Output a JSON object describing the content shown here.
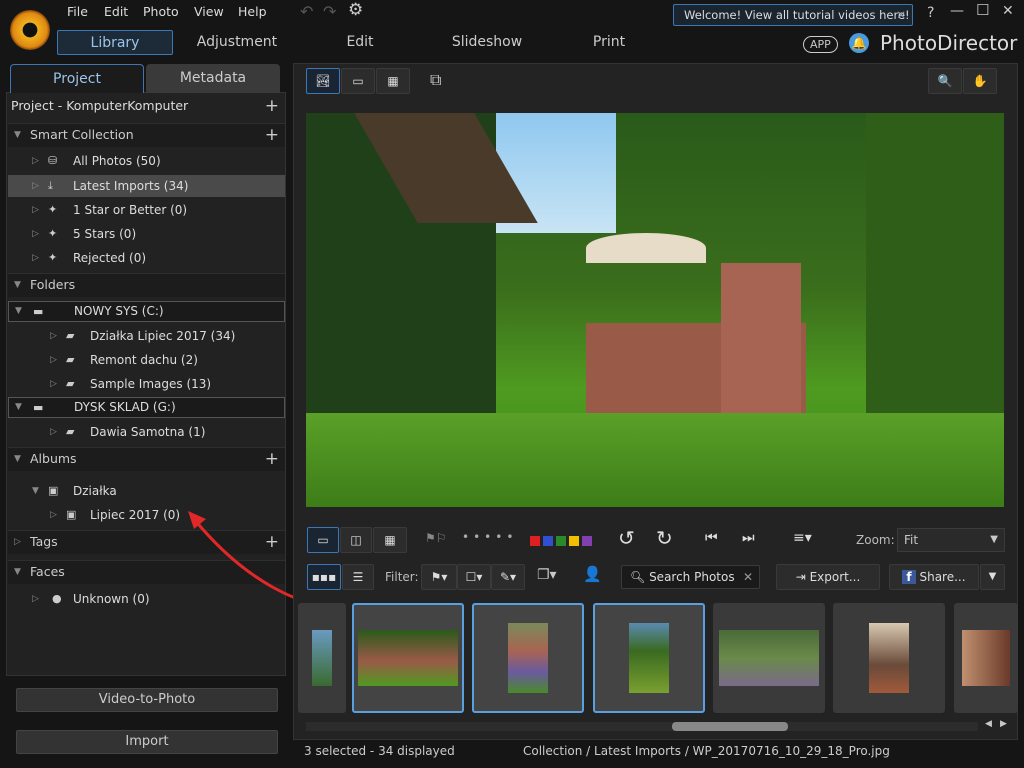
{
  "app": {
    "name": "PhotoDirector",
    "app_badge": "APP",
    "welcome": "Welcome! View all tutorial videos here!",
    "help": "?"
  },
  "menu": [
    "File",
    "Edit",
    "Photo",
    "View",
    "Help"
  ],
  "main_tabs": [
    "Library",
    "Adjustment",
    "Edit",
    "Slideshow",
    "Print"
  ],
  "left": {
    "tabs": [
      "Project",
      "Metadata"
    ],
    "project_title": "Project - KomputerKomputer",
    "smart_collection": {
      "label": "Smart Collection",
      "items": [
        "All Photos (50)",
        "Latest Imports (34)",
        "1 Star or Better (0)",
        "5 Stars (0)",
        "Rejected (0)"
      ]
    },
    "folders": {
      "label": "Folders",
      "drives": [
        {
          "label": "NOWY SYS (C:)",
          "items": [
            "Działka Lipiec 2017 (34)",
            "Remont dachu (2)",
            "Sample Images (13)"
          ]
        },
        {
          "label": "DYSK SKLAD (G:)",
          "items": [
            "Dawia Samotna (1)"
          ]
        }
      ]
    },
    "albums": {
      "label": "Albums",
      "group": "Działka",
      "items": [
        "Lipiec 2017 (0)"
      ]
    },
    "tags": {
      "label": "Tags"
    },
    "faces": {
      "label": "Faces",
      "items": [
        "Unknown (0)"
      ]
    },
    "video_to_photo": "Video-to-Photo",
    "import": "Import"
  },
  "toolbar": {
    "zoom_label": "Zoom:",
    "zoom_value": "Fit",
    "filter_label": "Filter:",
    "search_placeholder": "Search Photos",
    "export": "Export...",
    "share": "Share...",
    "color_labels": [
      "#e02020",
      "#3050d0",
      "#2a8a2a",
      "#f0c000",
      "#8040b0"
    ]
  },
  "status": {
    "selected": "3 selected - 34 displayed",
    "path": "Collection / Latest Imports / WP_20170716_10_29_18_Pro.jpg"
  },
  "accent": "#3b78b5"
}
